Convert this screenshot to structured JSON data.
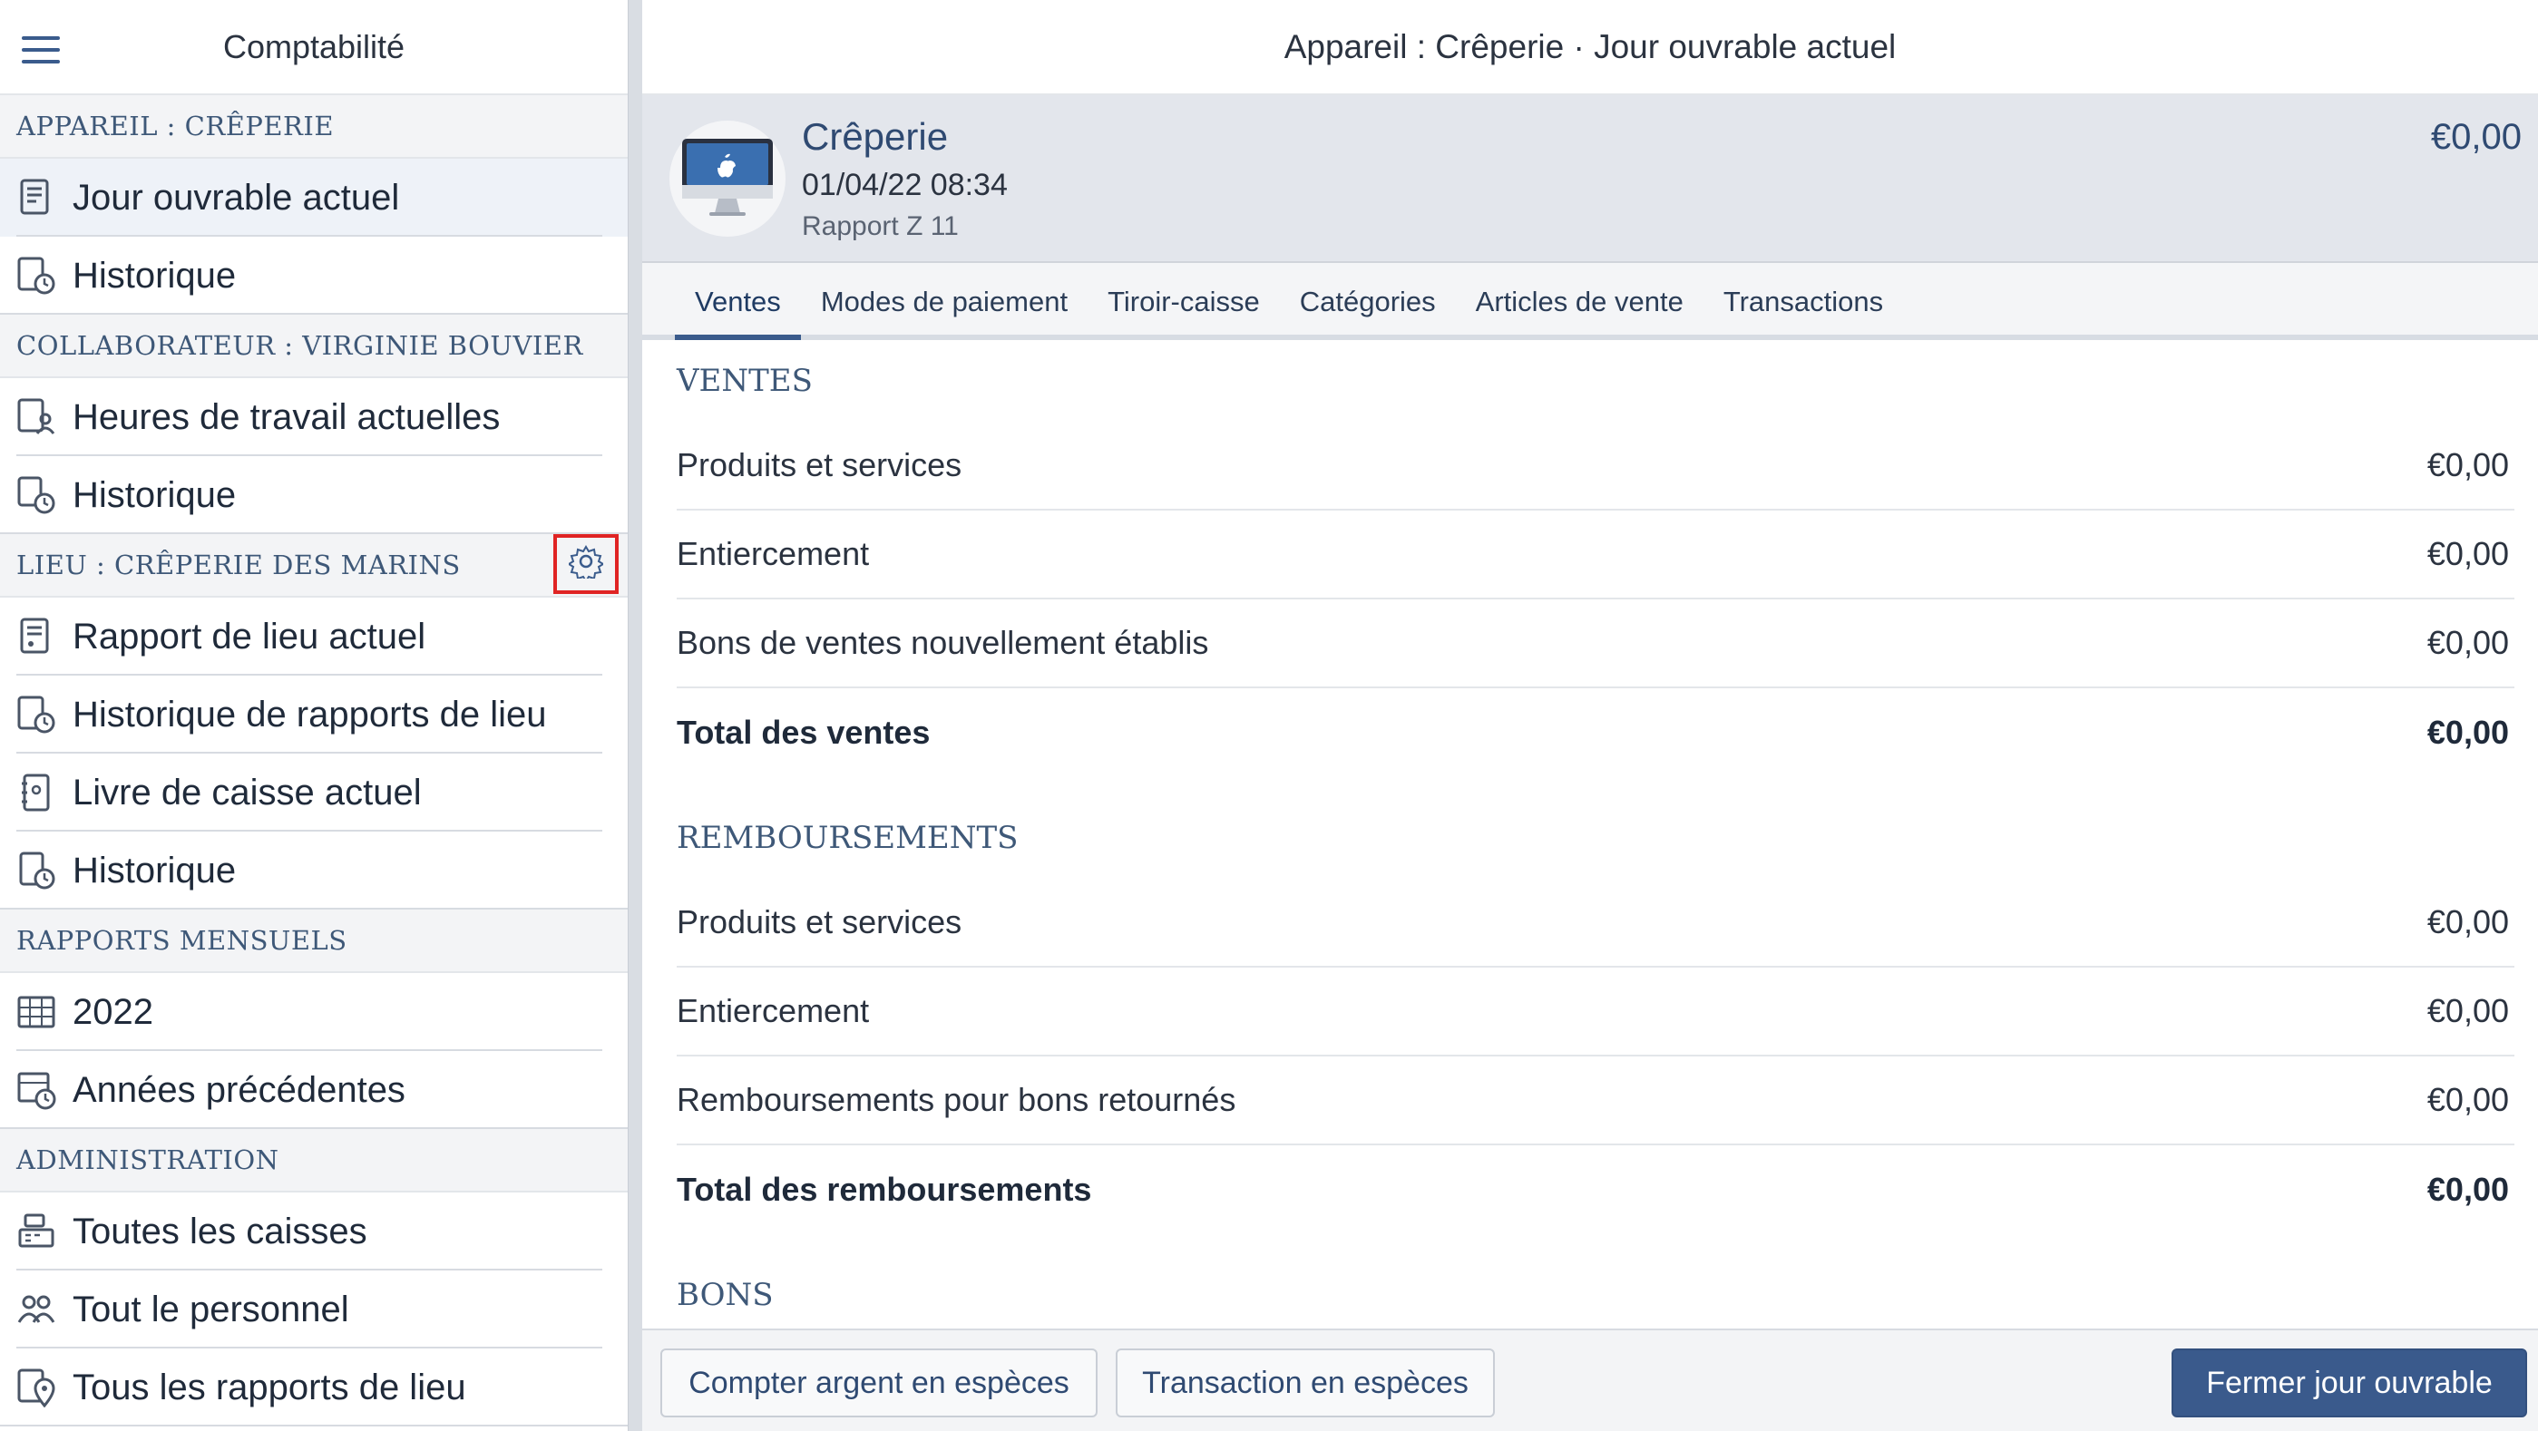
{
  "app": {
    "sidebar_title": "Comptabilité",
    "topbar_title": "Appareil : Crêperie · Jour ouvrable actuel"
  },
  "sidebar": {
    "sections": [
      {
        "title": "APPAREIL : CRÊPERIE",
        "items": [
          {
            "label": "Jour ouvrable actuel",
            "icon": "receipt-icon",
            "active": true
          },
          {
            "label": "Historique",
            "icon": "receipt-history-icon"
          }
        ]
      },
      {
        "title": "COLLABORATEUR : VIRGINIE BOUVIER",
        "items": [
          {
            "label": "Heures de travail actuelles",
            "icon": "staff-receipt-icon"
          },
          {
            "label": "Historique",
            "icon": "staff-history-icon"
          }
        ]
      },
      {
        "title": "LIEU : CRÊPERIE DES MARINS",
        "settings_icon": "gear-icon",
        "items": [
          {
            "label": "Rapport de lieu actuel",
            "icon": "location-report-icon"
          },
          {
            "label": "Historique de rapports de lieu",
            "icon": "location-history-icon"
          },
          {
            "label": "Livre de caisse actuel",
            "icon": "cashbook-icon"
          },
          {
            "label": "Historique",
            "icon": "cashbook-history-icon"
          }
        ]
      },
      {
        "title": "RAPPORTS MENSUELS",
        "items": [
          {
            "label": "2022",
            "icon": "calendar-icon"
          },
          {
            "label": "Années précédentes",
            "icon": "calendar-history-icon"
          }
        ]
      },
      {
        "title": "ADMINISTRATION",
        "items": [
          {
            "label": "Toutes les caisses",
            "icon": "register-icon"
          },
          {
            "label": "Tout le personnel",
            "icon": "people-icon"
          },
          {
            "label": "Tous les rapports de lieu",
            "icon": "location-pin-icon"
          }
        ]
      }
    ]
  },
  "device": {
    "name": "Crêperie",
    "datetime": "01/04/22 08:34",
    "report": "Rapport Z 11",
    "amount": "€0,00",
    "icon": "imac-icon"
  },
  "tabs": [
    {
      "label": "Ventes",
      "active": true
    },
    {
      "label": "Modes de paiement"
    },
    {
      "label": "Tiroir-caisse"
    },
    {
      "label": "Catégories"
    },
    {
      "label": "Articles de vente"
    },
    {
      "label": "Transactions"
    }
  ],
  "groups": [
    {
      "title": "VENTES",
      "rows": [
        {
          "name": "Produits et services",
          "value": "€0,00"
        },
        {
          "name": "Entiercement",
          "value": "€0,00"
        },
        {
          "name": "Bons de ventes nouvellement établis",
          "value": "€0,00"
        }
      ],
      "total": {
        "name": "Total des ventes",
        "value": "€0,00"
      }
    },
    {
      "title": "REMBOURSEMENTS",
      "rows": [
        {
          "name": "Produits et services",
          "value": "€0,00"
        },
        {
          "name": "Entiercement",
          "value": "€0,00"
        },
        {
          "name": "Remboursements pour bons retournés",
          "value": "€0,00"
        }
      ],
      "total": {
        "name": "Total des remboursements",
        "value": "€0,00"
      }
    },
    {
      "title": "BONS",
      "rows": [],
      "total": null
    }
  ],
  "footer": {
    "count_cash": "Compter argent en espèces",
    "cash_transaction": "Transaction en espèces",
    "close_day": "Fermer jour ouvrable"
  },
  "colors": {
    "accent": "#3a5b8c",
    "highlight_box": "#e02424",
    "section_text": "#3e5878"
  }
}
